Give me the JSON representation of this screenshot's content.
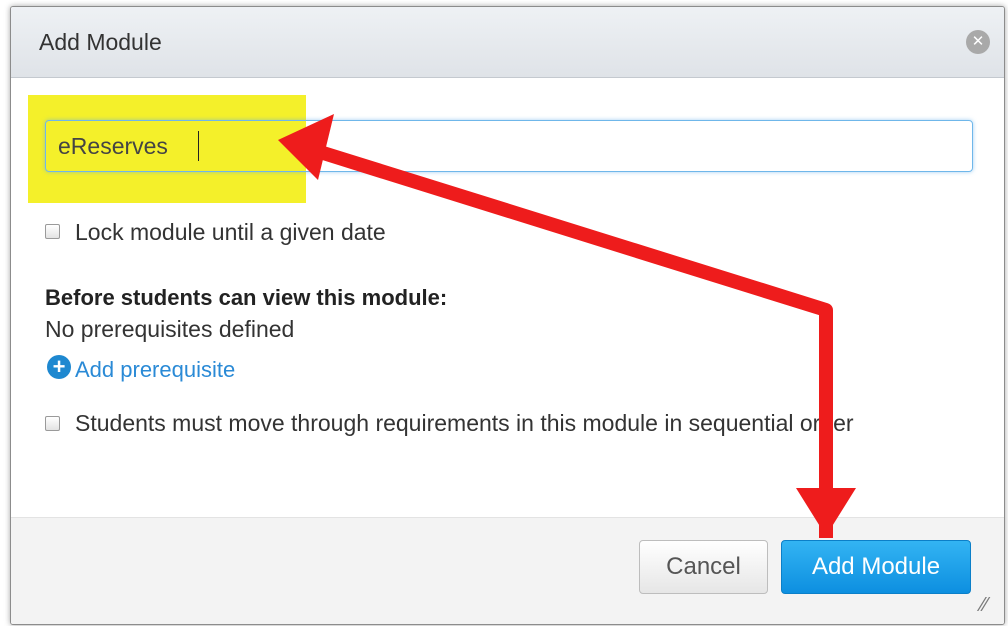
{
  "dialog": {
    "title": "Add Module",
    "close_icon": "close-icon"
  },
  "form": {
    "name_value": "eReserves",
    "lock_label": "Lock module until a given date",
    "lock_checked": false,
    "prereq_heading": "Before students can view this module:",
    "prereq_status": "No prerequisites defined",
    "add_prereq_label": "Add prerequisite",
    "sequential_label": "Students must move through requirements in this module in sequential order",
    "sequential_checked": false
  },
  "footer": {
    "cancel_label": "Cancel",
    "add_label": "Add Module"
  },
  "colors": {
    "annotation_arrow": "#ee1c1c",
    "highlight": "#f4f02a",
    "primary_button": "#1b9de8",
    "link": "#2a8ad6"
  }
}
